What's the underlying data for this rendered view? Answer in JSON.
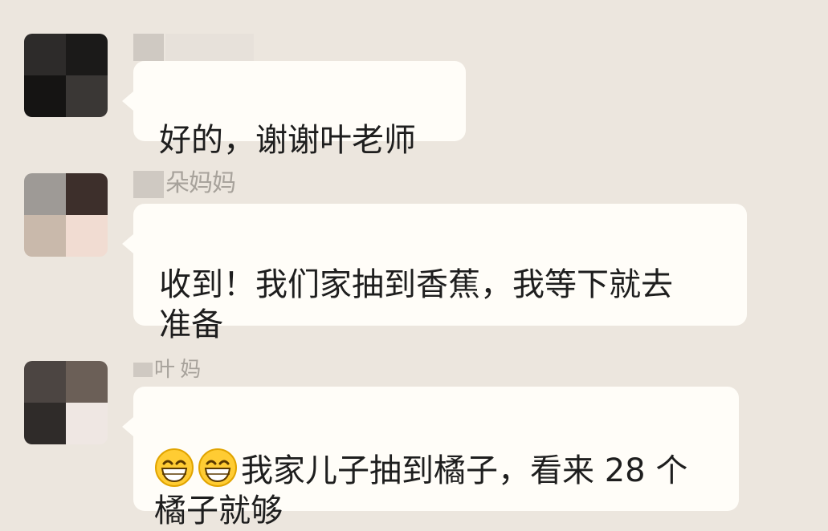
{
  "chat": {
    "messages": [
      {
        "sender": "",
        "text": "好的，谢谢叶老师",
        "avatar_colors": [
          "#2d2b2a",
          "#1b1a19",
          "#151413",
          "#3a3735"
        ]
      },
      {
        "sender": "朵妈妈",
        "text": "收到！我们家抽到香蕉，我等下就去\n准备",
        "avatar_colors": [
          "#9e9a96",
          "#3d2f2b",
          "#c9b9ab",
          "#f1dcd2"
        ]
      },
      {
        "sender": "叶 妈",
        "text": "我家儿子抽到橘子，看来 28 个\n橘子就够",
        "emoji": [
          "grinning-face-icon",
          "grinning-face-icon"
        ],
        "avatar_colors": [
          "#4c4542",
          "#6b5f57",
          "#2f2b29",
          "#efe7e3"
        ]
      }
    ],
    "colors": {
      "background": "#ece6de",
      "bubble": "#fffdf8",
      "text": "#1e1e1e",
      "sender": "#8e8a84"
    }
  }
}
